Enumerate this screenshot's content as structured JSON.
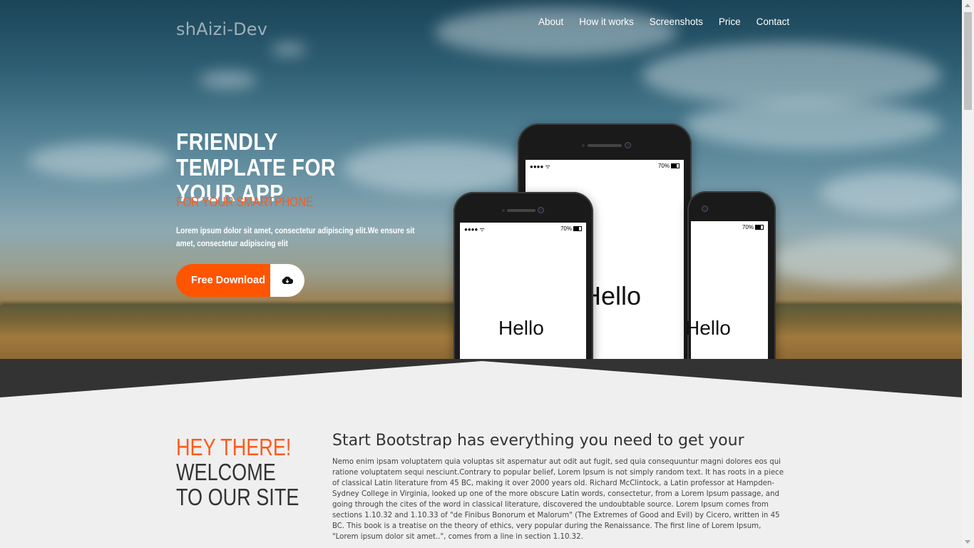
{
  "brand": "shAizi-Dev",
  "nav": [
    "About",
    "How it works",
    "Screenshots",
    "Price",
    "Contact"
  ],
  "hero": {
    "title": "FRIENDLY TEMPLATE FOR YOUR APP",
    "subtitle": "FOR YOUR SMARTPHONE",
    "description": "Lorem ipsum dolor sit amet, consectetur adipiscing elit.We ensure sit amet, consectetur adipiscing elit",
    "button_label": "Free Download",
    "button_icon": "cloud-download-icon"
  },
  "phones": {
    "battery": "70%",
    "screen_text": "Hello"
  },
  "about": {
    "hey": "HEY THERE!",
    "welcome": "WELCOME TO OUR SITE",
    "heading": "Start Bootstrap has everything you need to get your",
    "body": "Nemo enim ipsam voluptatem quia voluptas sit aspernatur aut odit aut fugit, sed quia consequuntur magni dolores eos qui ratione voluptatem sequi nesciunt.Contrary to popular belief, Lorem Ipsum is not simply random text. It has roots in a piece of classical Latin literature from 45 BC, making it over 2000 years old. Richard McClintock, a Latin professor at Hampden-Sydney College in Virginia, looked up one of the more obscure Latin words, consectetur, from a Lorem Ipsum passage, and going through the cites of the word in classical literature, discovered the undoubtable source. Lorem Ipsum comes from sections 1.10.32 and 1.10.33 of \"de Finibus Bonorum et Malorum\" (The Extremes of Good and Evil) by Cicero, written in 45 BC. This book is a treatise on the theory of ethics, very popular during the Renaissance. The first line of Lorem Ipsum, \"Lorem ipsum dolor sit amet..\", comes from a line in section 1.10.32."
  },
  "colors": {
    "accent": "#ff5500",
    "band": "#333333",
    "page_bg": "#efefef"
  }
}
